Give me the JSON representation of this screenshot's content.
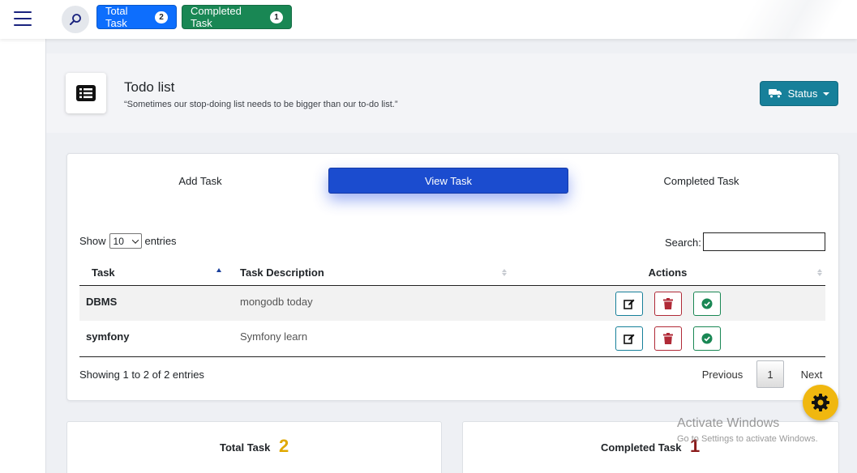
{
  "topbar": {
    "total_task_label": "Total Task",
    "total_task_count": "2",
    "completed_task_label": "Completed Task",
    "completed_task_count": "1"
  },
  "header": {
    "title": "Todo list",
    "subtitle": "“Sometimes our stop-doing list needs to be bigger than our to-do list.”",
    "status_button": "Status"
  },
  "tabs": {
    "add": "Add Task",
    "view": "View Task",
    "completed": "Completed Task"
  },
  "datatable": {
    "show_label": "Show",
    "entries_label": "entries",
    "length_value": "10",
    "search_label": "Search:",
    "search_value": "",
    "columns": [
      "Task",
      "Task Description",
      "Actions"
    ],
    "rows": [
      {
        "task": "DBMS",
        "description": "mongodb today"
      },
      {
        "task": "symfony",
        "description": "Symfony learn"
      }
    ],
    "info": "Showing 1 to 2 of 2 entries",
    "pagination": {
      "previous": "Previous",
      "page": "1",
      "next": "Next"
    }
  },
  "stats": {
    "total_label": "Total Task",
    "total_value": "2",
    "completed_label": "Completed Task",
    "completed_value": "1"
  },
  "watermark": {
    "title": "Activate Windows",
    "subtitle": "Go to Settings to activate Windows."
  },
  "colors": {
    "primary": "#0d6efd",
    "success": "#198754",
    "info": "#17809a",
    "active_tab": "#1b4ccf",
    "danger": "#b02a37",
    "warning": "#f0b70f"
  },
  "icons": [
    "menu-icon",
    "search-icon",
    "list-icon",
    "truck-icon",
    "edit-icon",
    "trash-icon",
    "check-circle-icon",
    "gear-icon"
  ]
}
